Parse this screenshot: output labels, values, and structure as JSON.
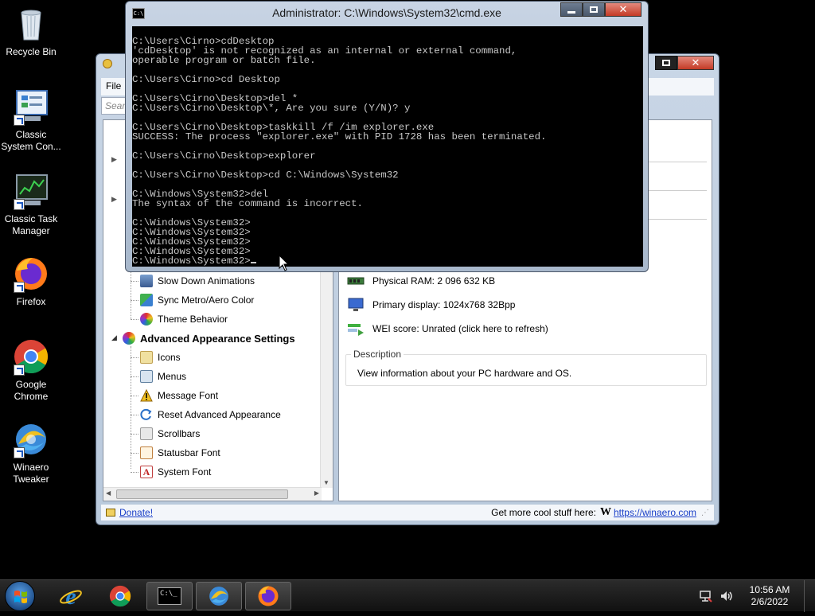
{
  "desktop": {
    "icons": [
      {
        "label": "Recycle Bin"
      },
      {
        "label": "Classic System Con..."
      },
      {
        "label": "Classic Task Manager"
      },
      {
        "label": "Firefox"
      },
      {
        "label": "Google Chrome"
      },
      {
        "label": "Winaero Tweaker"
      }
    ]
  },
  "tweaker": {
    "menu_file": "File",
    "search_placeholder": "Searc",
    "tree": {
      "items_a": [
        "Slow Down Animations",
        "Sync Metro/Aero Color",
        "Theme Behavior"
      ],
      "group": "Advanced Appearance Settings",
      "items_b": [
        "Icons",
        "Menus",
        "Message Font",
        "Reset Advanced Appearance",
        "Scrollbars",
        "Statusbar Font",
        "System Font"
      ]
    },
    "info": {
      "ram": "Physical RAM: 2 096 632 KB",
      "display": "Primary display: 1024x768 32Bpp",
      "wei": "WEI score: Unrated (click here to refresh)"
    },
    "description": {
      "label": "Description",
      "text": "View information about your PC hardware and OS."
    },
    "status": {
      "donate": "Donate!",
      "more": "Get more cool stuff here:",
      "w_logo": "W",
      "link": "https://winaero.com"
    }
  },
  "cmd": {
    "title": "Administrator: C:\\Windows\\System32\\cmd.exe",
    "icon_text": "C:\\",
    "lines": [
      "C:\\Users\\Cirno>cdDesktop",
      "'cdDesktop' is not recognized as an internal or external command,",
      "operable program or batch file.",
      "",
      "C:\\Users\\Cirno>cd Desktop",
      "",
      "C:\\Users\\Cirno\\Desktop>del *",
      "C:\\Users\\Cirno\\Desktop\\*, Are you sure (Y/N)? y",
      "",
      "C:\\Users\\Cirno\\Desktop>taskkill /f /im explorer.exe",
      "SUCCESS: The process \"explorer.exe\" with PID 1728 has been terminated.",
      "",
      "C:\\Users\\Cirno\\Desktop>explorer",
      "",
      "C:\\Users\\Cirno\\Desktop>cd C:\\Windows\\System32",
      "",
      "C:\\Windows\\System32>del",
      "The syntax of the command is incorrect.",
      "",
      "C:\\Windows\\System32>",
      "C:\\Windows\\System32>",
      "C:\\Windows\\System32>",
      "C:\\Windows\\System32>",
      "C:\\Windows\\System32>"
    ]
  },
  "taskbar": {
    "cmd_label": "C:\\_",
    "time": "10:56 AM",
    "date": "2/6/2022"
  }
}
